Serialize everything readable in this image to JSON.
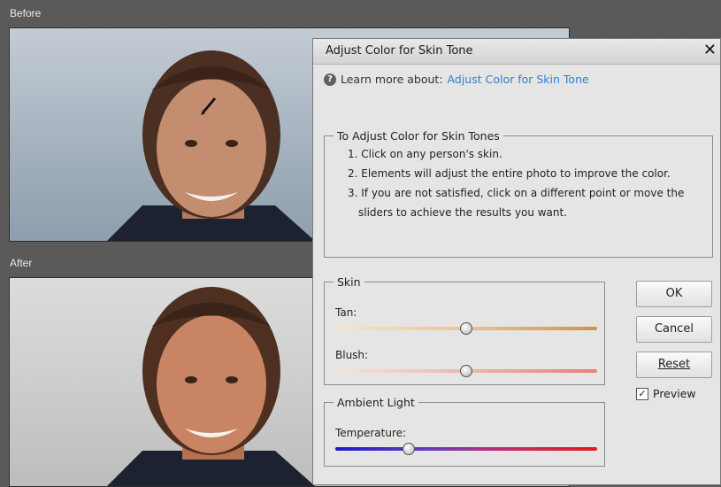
{
  "panes": {
    "before_label": "Before",
    "after_label": "After"
  },
  "dialog": {
    "title": "Adjust Color for Skin Tone",
    "close_icon": "close-icon",
    "learn_more_label": "Learn more about:",
    "learn_more_link": "Adjust Color for Skin Tone",
    "instructions": {
      "legend": "To Adjust Color for Skin Tones",
      "steps": [
        "1. Click on any person's skin.",
        "2. Elements will adjust the entire photo to improve the color.",
        "3. If you are not satisfied, click on a different point or move the sliders to achieve the results you want."
      ]
    },
    "skin": {
      "legend": "Skin",
      "tan_label": "Tan:",
      "tan_value": 0.5,
      "blush_label": "Blush:",
      "blush_value": 0.5
    },
    "ambient": {
      "legend": "Ambient Light",
      "temperature_label": "Temperature:",
      "temperature_value": 0.28
    },
    "buttons": {
      "ok": "OK",
      "cancel": "Cancel",
      "reset": "Reset"
    },
    "preview": {
      "label": "Preview",
      "checked": true
    }
  }
}
